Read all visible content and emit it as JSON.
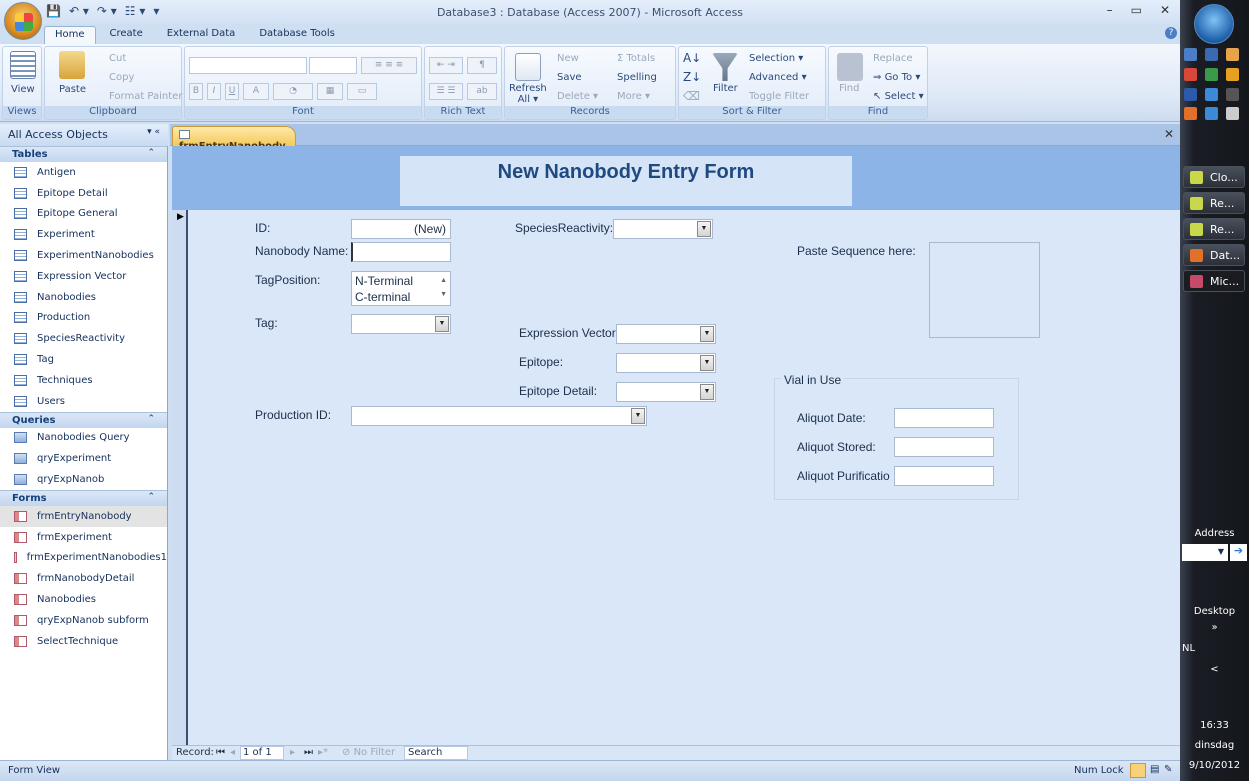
{
  "window": {
    "title": "Database3 : Database (Access 2007) - Microsoft Access",
    "minimize": "–",
    "restore": "▭",
    "close": "✕"
  },
  "qat": [
    "💾",
    "↶ ▾",
    "↷ ▾",
    "☷ ▾",
    "▾"
  ],
  "ribbon_tabs": [
    "Home",
    "Create",
    "External Data",
    "Database Tools"
  ],
  "help": "?",
  "ribbon": {
    "views": {
      "label": "Views",
      "view": "View"
    },
    "clipboard": {
      "label": "Clipboard",
      "paste": "Paste",
      "cut": "Cut",
      "copy": "Copy",
      "format_painter": "Format Painter"
    },
    "font": {
      "label": "Font",
      "bold": "B",
      "italic": "I",
      "underline": "U",
      "font_color": "A"
    },
    "rich_text": {
      "label": "Rich Text"
    },
    "records": {
      "label": "Records",
      "refresh": "Refresh",
      "refresh_all": "All ▾",
      "new": "New",
      "save": "Save",
      "delete": "Delete ▾",
      "totals": "Σ Totals",
      "spelling": "Spelling",
      "more": "More ▾"
    },
    "sort_filter": {
      "label": "Sort & Filter",
      "filter": "Filter",
      "selection": "Selection ▾",
      "advanced": "Advanced ▾",
      "toggle_filter": "Toggle Filter"
    },
    "find": {
      "label": "Find",
      "find": "Find",
      "replace": "Replace",
      "goto": "Go To ▾",
      "select": "Select ▾"
    }
  },
  "nav": {
    "header": "All Access Objects",
    "sections": [
      {
        "title": "Tables",
        "type": "t",
        "items": [
          "Antigen",
          "Epitope Detail",
          "Epitope General",
          "Experiment",
          "ExperimentNanobodies",
          "Expression Vector",
          "Nanobodies",
          "Production",
          "SpeciesReactivity",
          "Tag",
          "Techniques",
          "Users"
        ]
      },
      {
        "title": "Queries",
        "type": "q",
        "items": [
          "Nanobodies Query",
          "qryExperiment",
          "qryExpNanob"
        ]
      },
      {
        "title": "Forms",
        "type": "f",
        "items": [
          "frmEntryNanobody",
          "frmExperiment",
          "frmExperimentNanobodies1",
          "frmNanobodyDetail",
          "Nanobodies",
          "qryExpNanob subform",
          "SelectTechnique"
        ]
      }
    ],
    "selected": "frmEntryNanobody"
  },
  "doc_tab": "frmEntryNanobody",
  "form": {
    "title": "New Nanobody Entry Form",
    "id_label": "ID:",
    "id_value": "(New)",
    "name_label": "Nanobody Name:",
    "name_value": "",
    "tagpos_label": "TagPosition:",
    "tagpos_options": [
      "N-Terminal",
      "C-terminal"
    ],
    "tag_label": "Tag:",
    "species_label": "SpeciesReactivity:",
    "expr_label": "Expression Vector",
    "epitope_label": "Epitope:",
    "epitope_detail_label": "Epitope Detail:",
    "production_label": "Production ID:",
    "sequence_label": "Paste Sequence here:",
    "vial_title": "Vial in Use",
    "aliquot_date": "Aliquot Date:",
    "aliquot_stored": "Aliquot Stored:",
    "aliquot_purification": "Aliquot Purificatio"
  },
  "record_nav": {
    "label": "Record:",
    "position": "1 of 1",
    "no_filter": "No Filter",
    "search": "Search"
  },
  "status": {
    "view": "Form View",
    "num_lock": "Num Lock"
  },
  "taskbar": {
    "buttons": [
      "Clo...",
      "Re...",
      "Re...",
      "Dat...",
      "Mic..."
    ],
    "address": "Address",
    "desktop": "Desktop",
    "lang": "NL",
    "time": "16:33",
    "day": "dinsdag",
    "date": "9/10/2012"
  }
}
